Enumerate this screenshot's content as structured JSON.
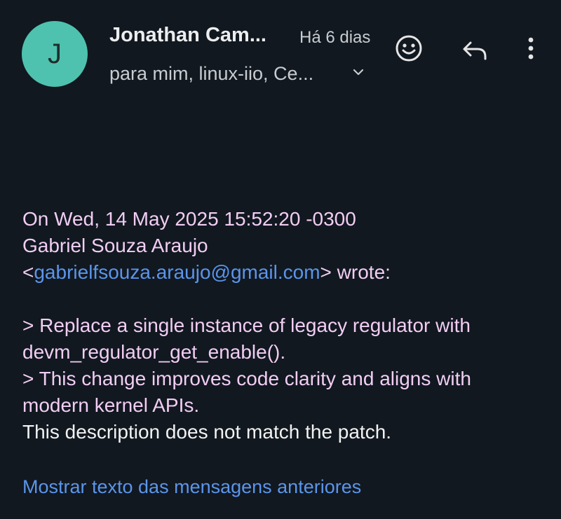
{
  "header": {
    "avatar_letter": "J",
    "sender_name": "Jonathan Cam...",
    "timestamp": "Há 6 dias",
    "recipients": "para mim, linux-iio, Ce..."
  },
  "icons": {
    "avatar_color": "#4ec2ae",
    "emoji": "smiley-icon",
    "reply": "reply-icon",
    "more": "more-vert-icon",
    "expand": "chevron-down-icon"
  },
  "message": {
    "quote_line1": "On Wed, 14 May 2025 15:52:20 -0300",
    "quote_line2": "Gabriel Souza Araujo",
    "email_open": "<",
    "email": "gabrielfsouza.araujo@gmail.com",
    "email_close": "> wrote:",
    "quoted_1a": "> Replace a single instance of legacy regulator with",
    "quoted_1b": "devm_regulator_get_enable().",
    "quoted_2a": "> This change improves code clarity and aligns with",
    "quoted_2b": "modern kernel APIs.",
    "reply": "This description does not match the patch."
  },
  "footer": {
    "show_previous": "Mostrar texto das mensagens anteriores"
  },
  "colors": {
    "background": "#111820",
    "quote_text": "#f2cdf3",
    "link": "#5b95ea"
  }
}
